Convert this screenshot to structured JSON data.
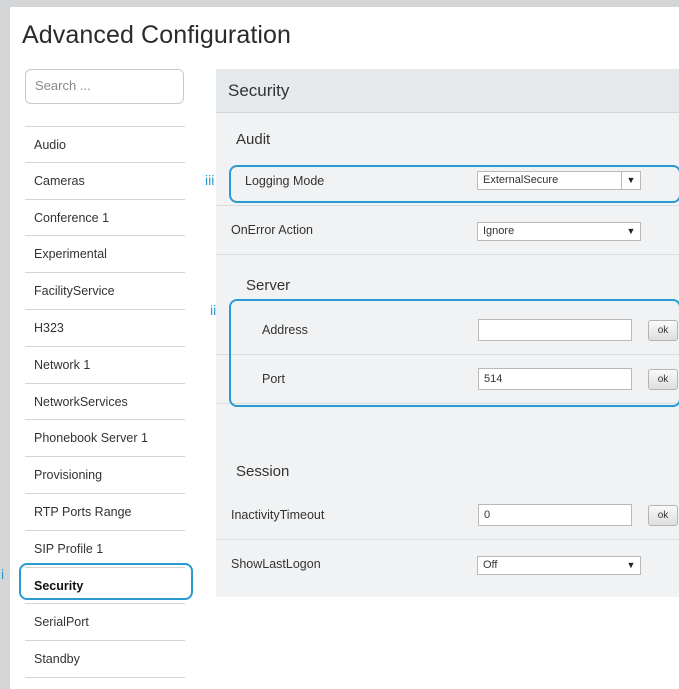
{
  "title": "Advanced Configuration",
  "search": {
    "placeholder": "Search ..."
  },
  "sidebar": {
    "items": [
      {
        "label": "Audio"
      },
      {
        "label": "Cameras"
      },
      {
        "label": "Conference 1"
      },
      {
        "label": "Experimental"
      },
      {
        "label": "FacilityService"
      },
      {
        "label": "H323"
      },
      {
        "label": "Network 1"
      },
      {
        "label": "NetworkServices"
      },
      {
        "label": "Phonebook Server 1"
      },
      {
        "label": "Provisioning"
      },
      {
        "label": "RTP Ports Range"
      },
      {
        "label": "SIP Profile 1"
      },
      {
        "label": "Security"
      },
      {
        "label": "SerialPort"
      },
      {
        "label": "Standby"
      }
    ],
    "active": "Security"
  },
  "panel": {
    "header": "Security",
    "audit": {
      "title": "Audit",
      "logging_mode": {
        "label": "Logging Mode",
        "value": "ExternalSecure"
      },
      "onerror_action": {
        "label": "OnError Action",
        "value": "Ignore"
      }
    },
    "server": {
      "title": "Server",
      "address": {
        "label": "Address",
        "value": "",
        "ok": "ok"
      },
      "port": {
        "label": "Port",
        "value": "514",
        "ok": "ok"
      }
    },
    "session": {
      "title": "Session",
      "inactivity_timeout": {
        "label": "InactivityTimeout",
        "value": "0",
        "ok": "ok"
      },
      "show_last_logon": {
        "label": "ShowLastLogon",
        "value": "Off"
      }
    }
  },
  "callouts": {
    "i": "i",
    "ii": "ii",
    "iii": "iii"
  },
  "accent_color": "#2a9ad3"
}
